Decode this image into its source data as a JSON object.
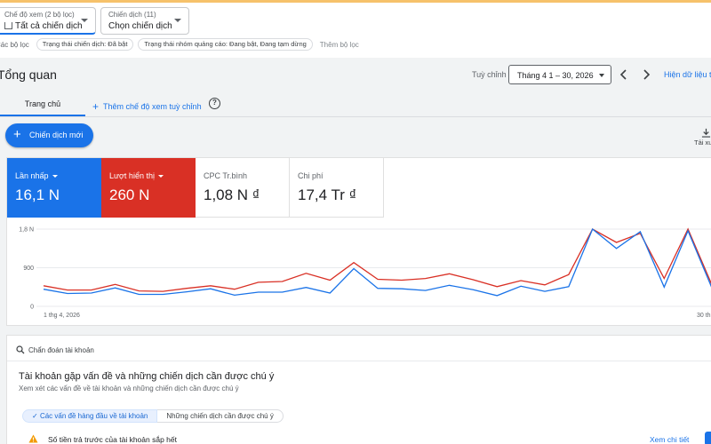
{
  "filters": {
    "view_label": "Chế độ xem (2 bộ lọc)",
    "view_value": "Tất cả chiến dịch",
    "campaign_label": "Chiến dịch (11)",
    "campaign_value": "Chọn chiến dịch",
    "chips_label": "Các bộ lọc",
    "chips": [
      "Trạng thái chiến dịch: Đã bật",
      "Trạng thái nhóm quảng cáo: Đang bật, Đang tạm dừng"
    ],
    "add_filter": "Thêm bộ lọc"
  },
  "header": {
    "title": "Tổng quan",
    "range_label": "Tuỳ chỉnh",
    "range_value": "Tháng 4 1 – 30, 2026",
    "show_link": "Hiện dữ liệu tr"
  },
  "tabs": {
    "home": "Trang chủ",
    "add_view": "Thêm chế độ xem tuỳ chỉnh",
    "help": "?"
  },
  "actions": {
    "new_campaign": "Chiến dịch mới",
    "download": "Tải xu"
  },
  "metrics": [
    {
      "label": "Lần nhấp",
      "value": "16,1 N"
    },
    {
      "label": "Lượt hiển thị",
      "value": "260 N"
    },
    {
      "label": "CPC Tr.bình",
      "value": "1,08 N ₫"
    },
    {
      "label": "Chi phí",
      "value": "17,4 Tr ₫"
    }
  ],
  "colors": {
    "clicks": "#1a73e8",
    "impressions": "#d93025",
    "grid": "#e8eaed"
  },
  "chart_data": {
    "type": "line",
    "x_start_label": "1 thg 4, 2026",
    "x_end_label": "30 th",
    "y_ticks": [
      "1,8 N",
      "900",
      "0"
    ],
    "ylim": [
      0,
      1800
    ],
    "series": [
      {
        "name": "Lượt hiển thị",
        "values": [
          480,
          380,
          380,
          510,
          360,
          350,
          420,
          480,
          400,
          560,
          580,
          770,
          610,
          1020,
          630,
          610,
          650,
          760,
          620,
          460,
          600,
          500,
          740,
          1800,
          1490,
          1700,
          650,
          1800,
          500
        ]
      },
      {
        "name": "Lần nhấp",
        "values": [
          400,
          300,
          310,
          430,
          280,
          280,
          340,
          410,
          260,
          330,
          330,
          440,
          310,
          880,
          420,
          410,
          370,
          490,
          390,
          250,
          470,
          350,
          460,
          1800,
          1350,
          1740,
          450,
          1760,
          430
        ]
      }
    ]
  },
  "diagnostics": {
    "header": "Chẩn đoán tài khoản",
    "title": "Tài khoản gặp vấn đề và những chiến dịch cần được chú ý",
    "subtitle": "Xem xét các vấn đề về tài khoản và những chiến dịch cần được chú ý",
    "seg_selected": "Các vấn đề hàng đầu về tài khoản",
    "seg_other": "Những chiến dịch cần được chú ý",
    "issue": "Số tiền trả trước của tài khoản sắp hết",
    "detail_link": "Xem chi tiết"
  }
}
